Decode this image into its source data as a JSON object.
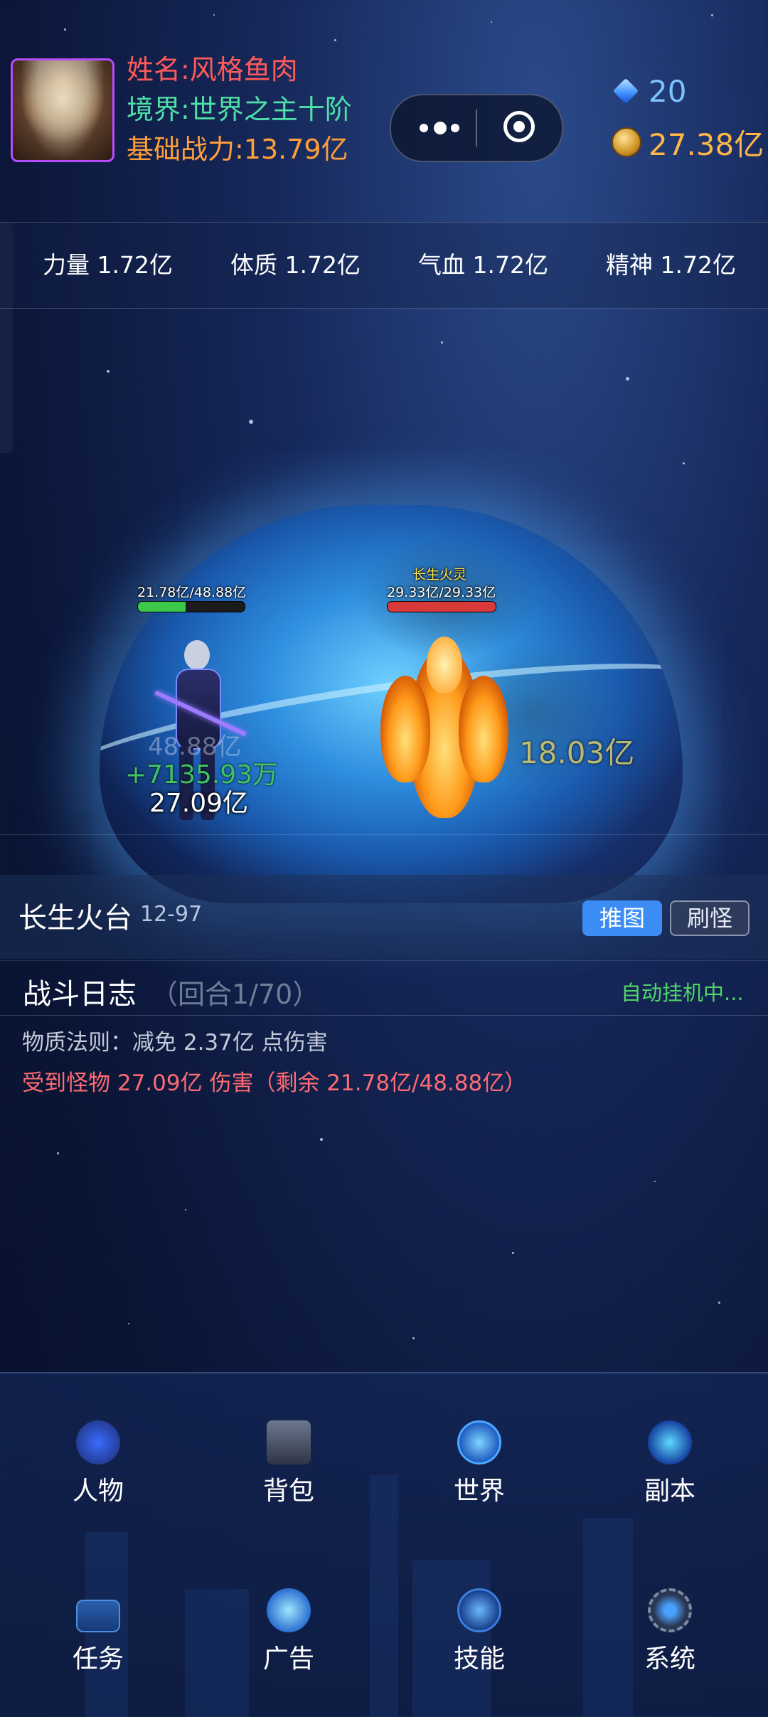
{
  "player": {
    "name": "姓名:风格鱼肉",
    "realm": "境界:世界之主十阶",
    "power": "基础战力:13.79亿"
  },
  "currency": {
    "gems": "20",
    "coins": "27.38亿"
  },
  "stats": [
    {
      "label": "力量 1.72亿"
    },
    {
      "label": "体质 1.72亿"
    },
    {
      "label": "气血 1.72亿"
    },
    {
      "label": "精神 1.72亿"
    }
  ],
  "battle": {
    "player_hp_text": "21.78亿/48.88亿",
    "player_hp_fraction": 0.4456,
    "monster_name": "长生火灵",
    "monster_hp_text": "29.33亿/29.33亿",
    "monster_hp_fraction": 1.0,
    "player_faded_number": "48.88亿",
    "heal_text": "+7135.93万",
    "damage_on_player": "27.09亿",
    "damage_on_monster": "18.03亿",
    "colors": {
      "player_hp": "#3cc84a",
      "monster_hp": "#d83a3a",
      "heal": "#3fc464"
    }
  },
  "stage": {
    "name": "长生火台",
    "code": "12-97",
    "push_button": "推图",
    "farm_button": "刷怪"
  },
  "log": {
    "title": "战斗日志",
    "round": "（回合1/70）",
    "status": "自动挂机中...",
    "lines": [
      "物质法则：减免 2.37亿 点伤害",
      "受到怪物 27.09亿 伤害（剩余 21.78亿/48.88亿）"
    ]
  },
  "nav": [
    {
      "label": "人物",
      "icon": "character-icon"
    },
    {
      "label": "背包",
      "icon": "backpack-icon"
    },
    {
      "label": "世界",
      "icon": "world-icon"
    },
    {
      "label": "副本",
      "icon": "dungeon-icon"
    },
    {
      "label": "任务",
      "icon": "task-icon"
    },
    {
      "label": "广告",
      "icon": "ad-icon"
    },
    {
      "label": "技能",
      "icon": "skill-icon"
    },
    {
      "label": "系统",
      "icon": "system-icon"
    }
  ]
}
